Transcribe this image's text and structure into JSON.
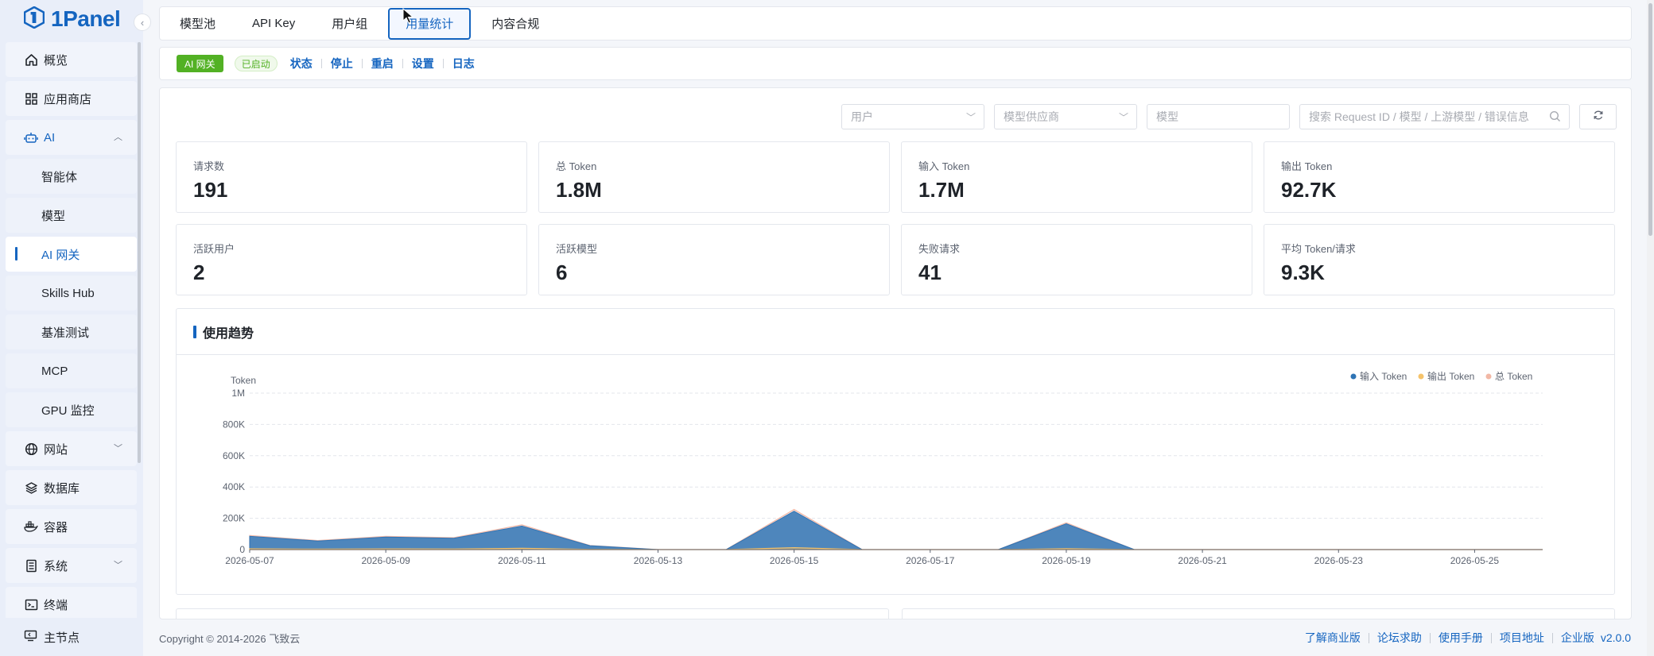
{
  "brand": {
    "name": "1Panel"
  },
  "sidebar": {
    "items": [
      {
        "label": "概览",
        "icon": "home-icon"
      },
      {
        "label": "应用商店",
        "icon": "grid-icon"
      },
      {
        "label": "AI",
        "icon": "robot-icon"
      },
      {
        "label": "智能体"
      },
      {
        "label": "模型"
      },
      {
        "label": "AI 网关"
      },
      {
        "label": "Skills Hub"
      },
      {
        "label": "基准测试"
      },
      {
        "label": "MCP"
      },
      {
        "label": "GPU 监控"
      },
      {
        "label": "网站",
        "icon": "globe-icon"
      },
      {
        "label": "数据库",
        "icon": "layers-icon"
      },
      {
        "label": "容器",
        "icon": "docker-icon"
      },
      {
        "label": "系统",
        "icon": "server-icon"
      },
      {
        "label": "终端",
        "icon": "terminal-icon"
      }
    ],
    "footer": {
      "label": "主节点",
      "icon": "node-icon"
    }
  },
  "tabs": [
    {
      "label": "模型池"
    },
    {
      "label": "API Key"
    },
    {
      "label": "用户组"
    },
    {
      "label": "用量统计"
    },
    {
      "label": "内容合规"
    }
  ],
  "status_bar": {
    "app_tag": "AI 网关",
    "status_tag": "已启动",
    "actions": [
      "状态",
      "停止",
      "重启",
      "设置",
      "日志"
    ]
  },
  "filters": {
    "user_placeholder": "用户",
    "provider_placeholder": "模型供应商",
    "model_placeholder": "模型",
    "search_placeholder": "搜索 Request ID / 模型 / 上游模型 / 错误信息"
  },
  "stats": [
    {
      "label": "请求数",
      "value": "191"
    },
    {
      "label": "总 Token",
      "value": "1.8M"
    },
    {
      "label": "输入 Token",
      "value": "1.7M"
    },
    {
      "label": "输出 Token",
      "value": "92.7K"
    },
    {
      "label": "活跃用户",
      "value": "2"
    },
    {
      "label": "活跃模型",
      "value": "6"
    },
    {
      "label": "失败请求",
      "value": "41"
    },
    {
      "label": "平均 Token/请求",
      "value": "9.3K"
    }
  ],
  "trend": {
    "title": "使用趋势"
  },
  "chart_data": {
    "type": "area",
    "ylabel": "Token",
    "ylim": [
      0,
      1000000
    ],
    "yticks": [
      {
        "value": 0,
        "label": "0"
      },
      {
        "value": 200000,
        "label": "200K"
      },
      {
        "value": 400000,
        "label": "400K"
      },
      {
        "value": 600000,
        "label": "600K"
      },
      {
        "value": 800000,
        "label": "800K"
      },
      {
        "value": 1000000,
        "label": "1M"
      }
    ],
    "x": [
      "2026-05-07",
      "2026-05-08",
      "2026-05-09",
      "2026-05-10",
      "2026-05-11",
      "2026-05-12",
      "2026-05-13",
      "2026-05-14",
      "2026-05-15",
      "2026-05-16",
      "2026-05-17",
      "2026-05-18",
      "2026-05-19",
      "2026-05-20",
      "2026-05-21",
      "2026-05-22",
      "2026-05-23",
      "2026-05-24",
      "2026-05-25",
      "2026-05-26"
    ],
    "xtick_labels": [
      "2026-05-07",
      "2026-05-09",
      "2026-05-11",
      "2026-05-13",
      "2026-05-15",
      "2026-05-17",
      "2026-05-19",
      "2026-05-21",
      "2026-05-23",
      "2026-05-25"
    ],
    "legend_position": "top-right",
    "grid": true,
    "series": [
      {
        "name": "输入 Token",
        "color": "#2f74b5",
        "values": [
          85000,
          55000,
          80000,
          72000,
          150000,
          25000,
          0,
          0,
          245000,
          0,
          0,
          0,
          165000,
          0,
          0,
          0,
          0,
          0,
          0,
          0
        ]
      },
      {
        "name": "输出 Token",
        "color": "#f5c36b",
        "values": [
          5000,
          3000,
          4500,
          4000,
          8000,
          1500,
          0,
          0,
          12000,
          0,
          0,
          0,
          6000,
          0,
          0,
          0,
          0,
          0,
          0,
          0
        ]
      },
      {
        "name": "总 Token",
        "color": "#f2b8a6",
        "values": [
          90000,
          58000,
          84500,
          76000,
          158000,
          26500,
          0,
          0,
          257000,
          0,
          0,
          0,
          171000,
          0,
          0,
          0,
          0,
          0,
          0,
          0
        ]
      }
    ]
  },
  "footer": {
    "copyright": "Copyright © 2014-2026 飞致云",
    "links": [
      "了解商业版",
      "论坛求助",
      "使用手册",
      "项目地址",
      "企业版"
    ],
    "version": "v2.0.0"
  },
  "colors": {
    "accent": "#1565c0",
    "success": "#52b124"
  }
}
